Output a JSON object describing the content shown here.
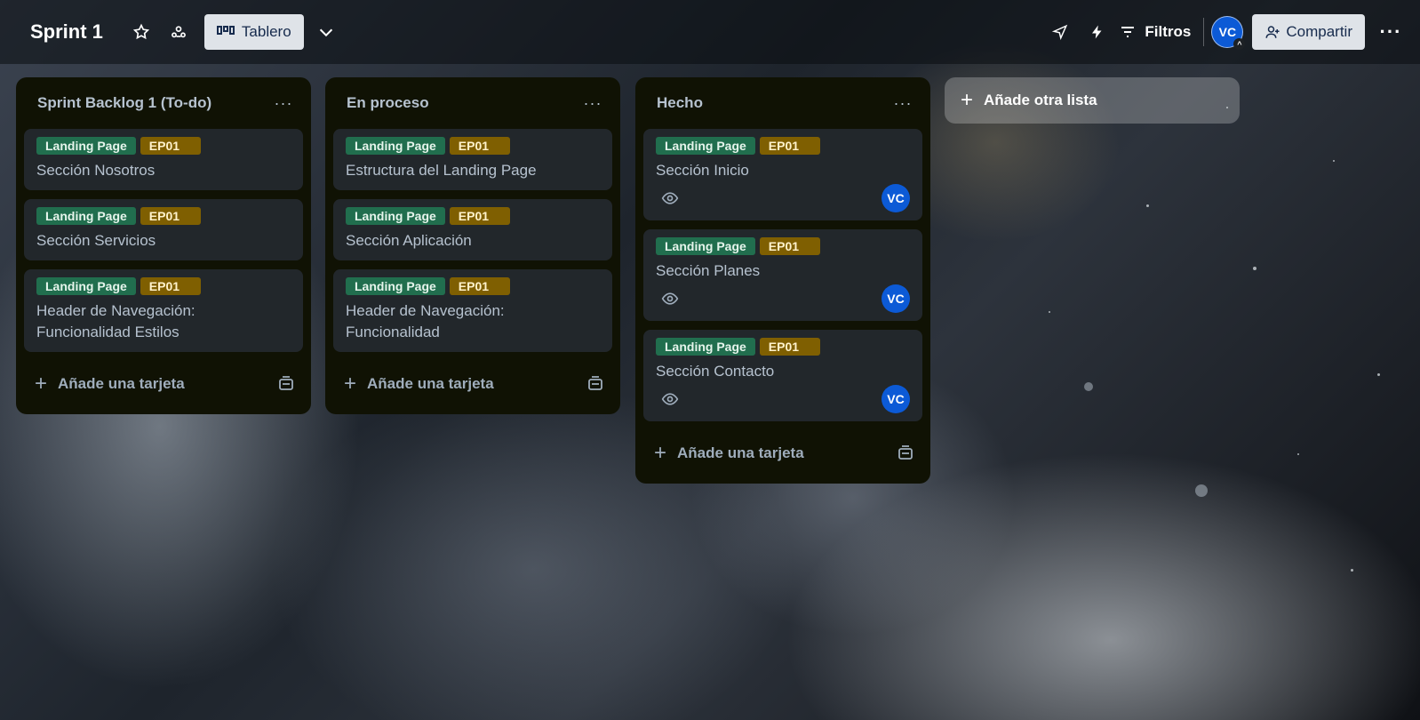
{
  "header": {
    "board_title": "Sprint 1",
    "view_label": "Tablero",
    "filters_label": "Filtros",
    "avatar_initials": "VC",
    "share_label": "Compartir",
    "more": "···"
  },
  "lists": [
    {
      "title": "Sprint Backlog 1 (To-do)",
      "menu": "···",
      "cards": [
        {
          "labels": [
            "Landing Page",
            "EP01"
          ],
          "title": "Sección Nosotros"
        },
        {
          "labels": [
            "Landing Page",
            "EP01"
          ],
          "title": "Sección Servicios"
        },
        {
          "labels": [
            "Landing Page",
            "EP01"
          ],
          "title": "Header de Navegación: Funcionalidad Estilos"
        }
      ],
      "add_card_label": "Añade una tarjeta"
    },
    {
      "title": "En proceso",
      "menu": "···",
      "cards": [
        {
          "labels": [
            "Landing Page",
            "EP01"
          ],
          "title": "Estructura del Landing Page"
        },
        {
          "labels": [
            "Landing Page",
            "EP01"
          ],
          "title": "Sección Aplicación"
        },
        {
          "labels": [
            "Landing Page",
            "EP01"
          ],
          "title": "Header de Navegación: Funcionalidad"
        }
      ],
      "add_card_label": "Añade una tarjeta"
    },
    {
      "title": "Hecho",
      "menu": "···",
      "cards": [
        {
          "labels": [
            "Landing Page",
            "EP01"
          ],
          "title": "Sección Inicio",
          "member": "VC"
        },
        {
          "labels": [
            "Landing Page",
            "EP01"
          ],
          "title": "Sección Planes",
          "member": "VC"
        },
        {
          "labels": [
            "Landing Page",
            "EP01"
          ],
          "title": "Sección Contacto",
          "member": "VC"
        }
      ],
      "add_card_label": "Añade una tarjeta"
    }
  ],
  "add_list_label": "Añade otra lista",
  "colors": {
    "label_green": "#216e4e",
    "label_yellow": "#7f5f01",
    "list_bg": "#101204",
    "card_bg": "#22272b",
    "avatar_blue": "#0c5ad6"
  }
}
